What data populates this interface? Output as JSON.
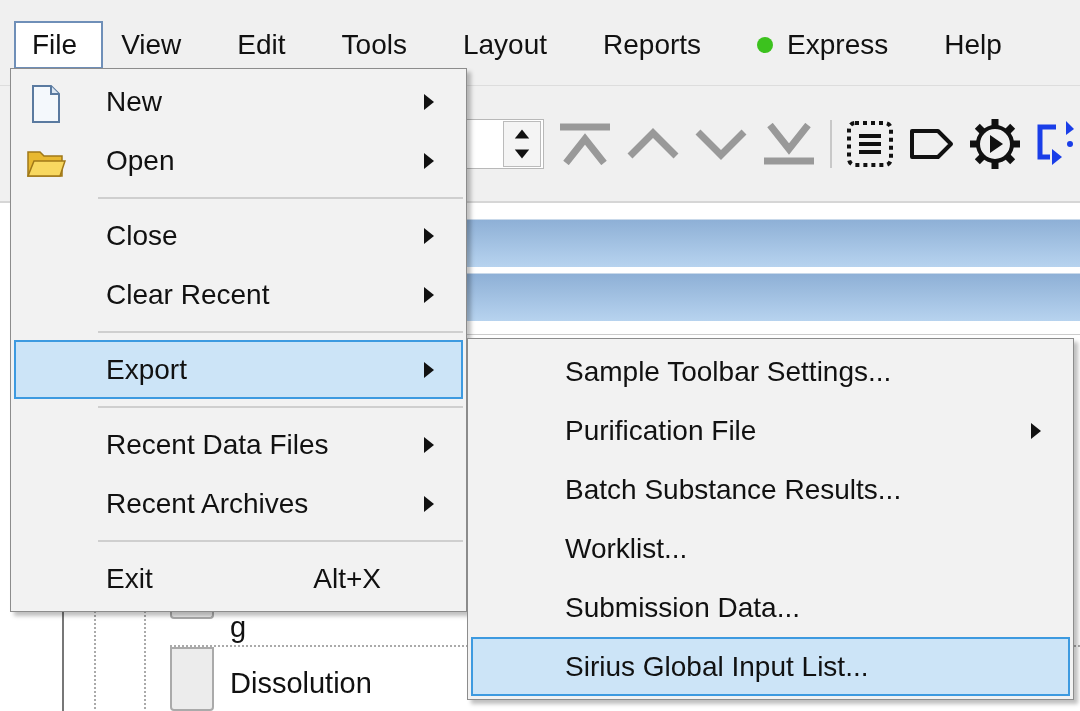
{
  "menu_bar": {
    "items": [
      {
        "label": "File",
        "selected": true,
        "kind": "menu"
      },
      {
        "label": "View",
        "selected": false,
        "kind": "menu"
      },
      {
        "label": "Edit",
        "selected": false,
        "kind": "menu"
      },
      {
        "label": "Tools",
        "selected": false,
        "kind": "menu"
      },
      {
        "label": "Layout",
        "selected": false,
        "kind": "menu"
      },
      {
        "label": "Reports",
        "selected": false,
        "kind": "menu"
      },
      {
        "label": "Express",
        "selected": false,
        "kind": "status",
        "color": "#3cc21e"
      },
      {
        "label": "Help",
        "selected": false,
        "kind": "menu"
      }
    ]
  },
  "file_menu": {
    "items": [
      {
        "kind": "item",
        "label": "New",
        "submenu": true,
        "selected": false
      },
      {
        "kind": "item",
        "label": "Open",
        "submenu": true,
        "selected": false
      },
      {
        "kind": "separator"
      },
      {
        "kind": "item",
        "label": "Close",
        "submenu": true,
        "selected": false
      },
      {
        "kind": "item",
        "label": "Clear Recent",
        "submenu": true,
        "selected": false
      },
      {
        "kind": "separator"
      },
      {
        "kind": "item",
        "label": "Export",
        "submenu": true,
        "selected": true
      },
      {
        "kind": "separator"
      },
      {
        "kind": "item",
        "label": "Recent Data Files",
        "submenu": true,
        "selected": false
      },
      {
        "kind": "item",
        "label": "Recent Archives",
        "submenu": true,
        "selected": false
      },
      {
        "kind": "separator"
      },
      {
        "kind": "item",
        "label": "Exit",
        "shortcut": "Alt+X",
        "submenu": false,
        "selected": false
      }
    ]
  },
  "export_submenu": {
    "items": [
      {
        "label": "Sample Toolbar Settings...",
        "submenu": false,
        "selected": false
      },
      {
        "label": "Purification File",
        "submenu": true,
        "selected": false
      },
      {
        "label": "Batch Substance Results...",
        "submenu": false,
        "selected": false
      },
      {
        "label": "Worklist...",
        "submenu": false,
        "selected": false
      },
      {
        "label": "Submission Data...",
        "submenu": false,
        "selected": false
      },
      {
        "label": "Sirius Global Input List...",
        "submenu": false,
        "selected": true
      }
    ]
  },
  "tree": {
    "rows": [
      {
        "label": "g"
      },
      {
        "label": "Dissolution"
      }
    ]
  }
}
